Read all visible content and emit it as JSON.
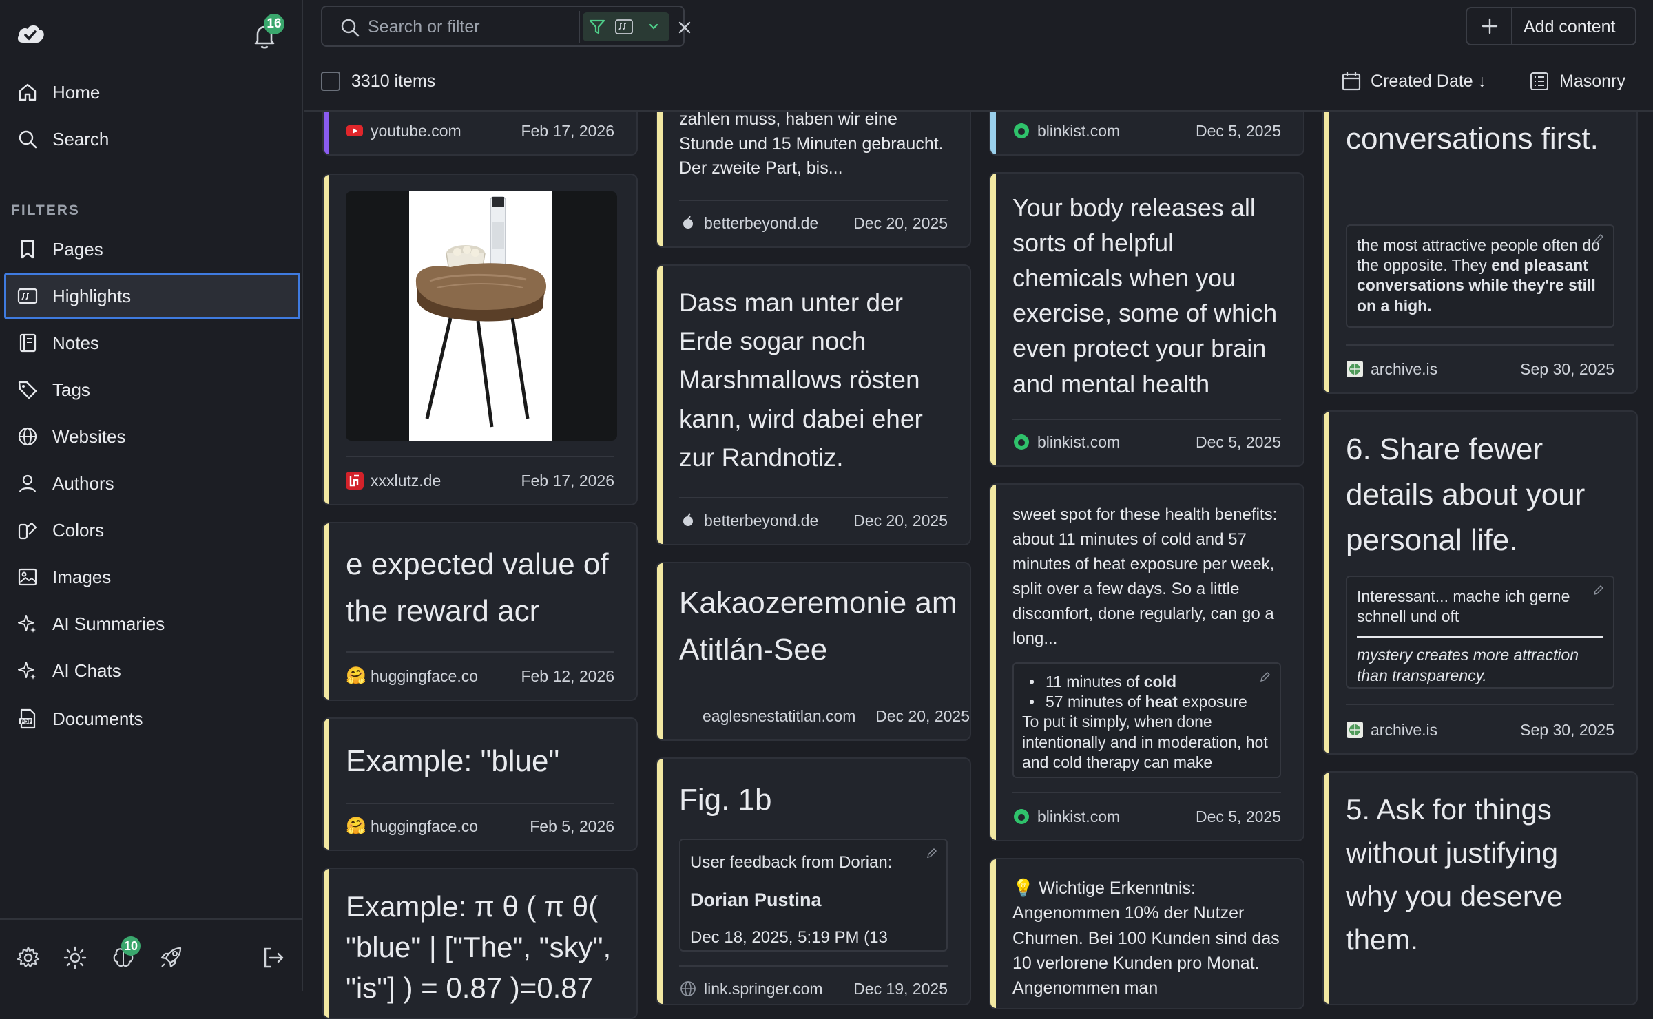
{
  "sidebar": {
    "notifications_badge": "16",
    "nav": [
      {
        "label": "Home",
        "icon": "home-icon"
      },
      {
        "label": "Search",
        "icon": "search-icon"
      }
    ],
    "filters_label": "FILTERS",
    "filters": [
      {
        "label": "Pages",
        "icon": "bookmark-icon"
      },
      {
        "label": "Highlights",
        "icon": "quote-icon",
        "active": true
      },
      {
        "label": "Notes",
        "icon": "notebook-icon"
      },
      {
        "label": "Tags",
        "icon": "tag-icon"
      },
      {
        "label": "Websites",
        "icon": "globe-icon"
      },
      {
        "label": "Authors",
        "icon": "user-icon"
      },
      {
        "label": "Colors",
        "icon": "swatch-icon"
      },
      {
        "label": "Images",
        "icon": "image-icon"
      },
      {
        "label": "AI Summaries",
        "icon": "sparkle-icon"
      },
      {
        "label": "AI Chats",
        "icon": "sparkle-icon"
      },
      {
        "label": "Documents",
        "icon": "pdf-icon"
      }
    ],
    "bottom_badge": "10"
  },
  "toolbar": {
    "search_placeholder": "Search or filter",
    "add_label": "Add content",
    "item_count": "3310 items",
    "sort_label": "Created Date ↓",
    "view_label": "Masonry"
  },
  "colors": {
    "accent_yellow": "#f2e8a2",
    "accent_blue": "#3f7be0",
    "badge_green": "#3aa76d"
  },
  "cards": {
    "c1": {
      "site": "youtube.com",
      "date": "Feb 17, 2026"
    },
    "c2": {
      "site": "xxxlutz.de",
      "date": "Feb 17, 2026"
    },
    "c3": {
      "text": "e expected value of the reward acr",
      "site": "huggingface.co",
      "date": "Feb 12, 2026"
    },
    "c4": {
      "text": "Example: \"blue\"",
      "site": "huggingface.co",
      "date": "Feb 5, 2026"
    },
    "c5": {
      "text": "Example: π θ ( π θ( \"blue\" | [\"The\", \"sky\", \"is\"] ) = 0.87 )=0.87"
    },
    "d1": {
      "text": "zahlen muss, haben wir eine Stunde und 15 Minuten gebraucht. Der zweite Part, bis...",
      "site": "betterbeyond.de",
      "date": "Dec 20, 2025"
    },
    "d2": {
      "text": "Dass man unter der Erde sogar noch Marshmallows rösten kann, wird dabei eher zur Randnotiz.",
      "site": "betterbeyond.de",
      "date": "Dec 20, 2025"
    },
    "d3": {
      "text": "Kakaozeremonie am Atitlán-See",
      "site": "eaglesnestatitlan.com",
      "date": "Dec 20, 2025"
    },
    "d4": {
      "text": "Fig. 1b",
      "note1": "User feedback from Dorian:",
      "note2": "Dorian Pustina",
      "note3": "Dec 18, 2025, 5:19 PM (13",
      "site": "link.springer.com",
      "date": "Dec 19, 2025"
    },
    "e1": {
      "site": "blinkist.com",
      "date": "Dec 5, 2025"
    },
    "e2": {
      "text": "Your body releases all sorts of helpful chemicals when you exercise, some of which even protect your brain and mental health",
      "site": "blinkist.com",
      "date": "Dec 5, 2025"
    },
    "e3": {
      "text": "sweet spot for these health benefits: about 11 minutes of cold and 57 minutes of heat exposure per week, split over a few days. So a little discomfort, done regularly, can go a long...",
      "li1a": "11 minutes of ",
      "li1b": "cold",
      "li2a": "57 minutes of ",
      "li2b": "heat",
      "li2c": " exposure",
      "note_tail": "To put it simply, when done intentionally and in moderation, hot and cold therapy can make",
      "site": "blinkist.com",
      "date": "Dec 5, 2025"
    },
    "e4": {
      "text": "💡 Wichtige Erkenntnis: Angenommen 10% der Nutzer Churnen. Bei 100 Kunden sind das 10 verlorene Kunden pro Monat. Angenommen man"
    },
    "f1": {
      "text": "conversations first.",
      "note_a": "the most attractive people often do the opposite. They ",
      "note_b": "end pleasant conversations while they're still on a high.",
      "site": "archive.is",
      "date": "Sep 30, 2025"
    },
    "f2": {
      "text": "6. Share fewer details about your personal life.",
      "note_a": "Interessant... mache ich gerne schnell und oft",
      "note_b": "mystery creates more attraction than transparency.",
      "site": "archive.is",
      "date": "Sep 30, 2025"
    },
    "f3": {
      "text": "5. Ask for things without justifying why you deserve them."
    }
  }
}
